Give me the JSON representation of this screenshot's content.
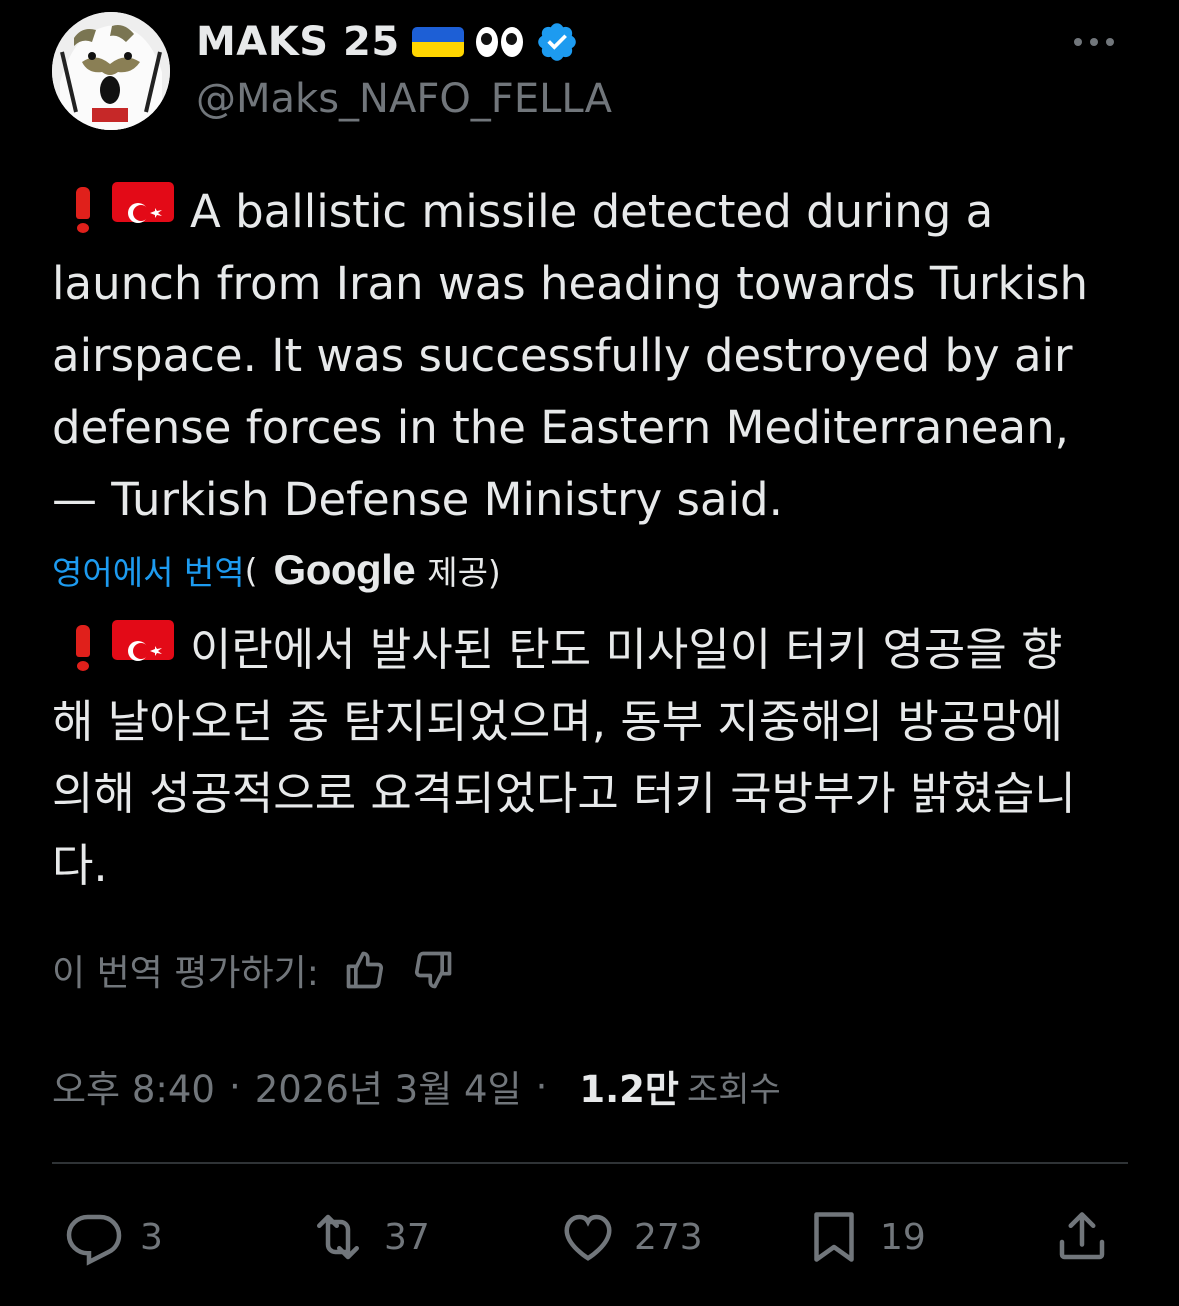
{
  "author": {
    "display_name": "MAKS 25",
    "handle": "@Maks_NAFO_FELLA",
    "emoji_icons": [
      "ukraine-flag-icon",
      "eyes-icon",
      "verified-badge-icon"
    ]
  },
  "tweet": {
    "text_lines": [
      "A ballistic missile detected during a",
      "launch from Iran was heading towards Turkish",
      "airspace. It was successfully destroyed by air",
      "defense forces in the Eastern Mediterranean,",
      "— Turkish Defense Ministry said."
    ],
    "lead_icons": [
      "exclamation-icon",
      "turkey-flag-icon"
    ]
  },
  "translation": {
    "link_label": "영어에서 번역",
    "open_paren": "(",
    "provider": "Google",
    "provided_label": "제공)",
    "text_lines": [
      "이란에서 발사된 탄도 미사일이 터키 영공을 향",
      "해 날아오던 중 탐지되었으며, 동부 지중해의 방공망에",
      "의해 성공적으로 요격되었다고 터키 국방부가 밝혔습니",
      "다."
    ],
    "rate_label": "이 번역 평가하기:"
  },
  "meta": {
    "time": "오후 8:40",
    "separator": "·",
    "date": "2026년 3월 4일",
    "views_count": "1.2만",
    "views_label": "조회수"
  },
  "actions": {
    "replies": "3",
    "reposts": "37",
    "likes": "273",
    "bookmarks": "19"
  },
  "colors": {
    "background": "#000000",
    "text": "#e7e9ea",
    "secondary": "#71767b",
    "link": "#1d9bf0",
    "verified": "#1d9bf0"
  }
}
